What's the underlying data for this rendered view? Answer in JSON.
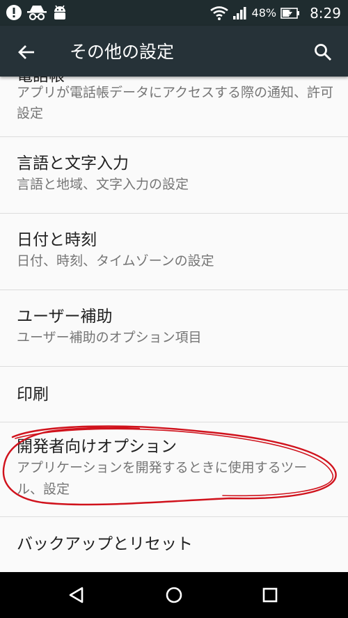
{
  "status_bar": {
    "battery_percent": "48%",
    "time": "8:29"
  },
  "app_bar": {
    "title": "その他の設定"
  },
  "list": {
    "partial_item": {
      "title": "電話帳",
      "subtitle": "アプリが電話帳データにアクセスする際の通知、許可設定"
    },
    "items": [
      {
        "title": "言語と文字入力",
        "subtitle": "言語と地域、文字入力の設定"
      },
      {
        "title": "日付と時刻",
        "subtitle": "日付、時刻、タイムゾーンの設定"
      },
      {
        "title": "ユーザー補助",
        "subtitle": "ユーザー補助のオプション項目"
      },
      {
        "title": "印刷"
      },
      {
        "title": "開発者向けオプション",
        "subtitle": "アプリケーションを開発するときに使用するツール、設定"
      },
      {
        "title": "バックアップとリセット"
      }
    ]
  },
  "colors": {
    "status_bar": "#1f2c2f",
    "app_bar": "#263238",
    "background": "#fafafa",
    "annotation": "#d0121c"
  }
}
